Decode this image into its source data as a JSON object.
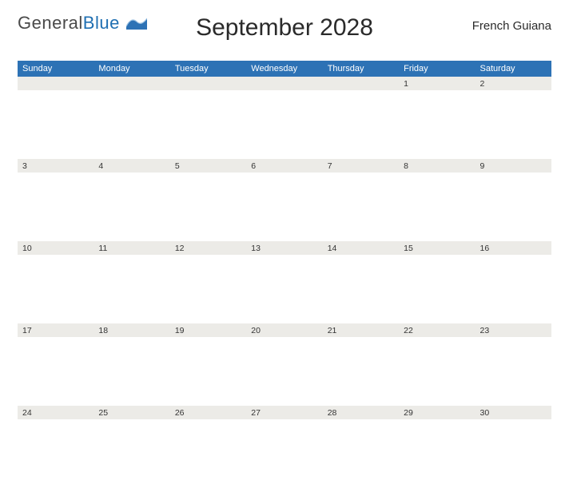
{
  "logo": {
    "part1": "General",
    "part2": "Blue"
  },
  "title": "September 2028",
  "region": "French Guiana",
  "day_headers": [
    "Sunday",
    "Monday",
    "Tuesday",
    "Wednesday",
    "Thursday",
    "Friday",
    "Saturday"
  ],
  "weeks": [
    [
      "",
      "",
      "",
      "",
      "",
      "1",
      "2"
    ],
    [
      "3",
      "4",
      "5",
      "6",
      "7",
      "8",
      "9"
    ],
    [
      "10",
      "11",
      "12",
      "13",
      "14",
      "15",
      "16"
    ],
    [
      "17",
      "18",
      "19",
      "20",
      "21",
      "22",
      "23"
    ],
    [
      "24",
      "25",
      "26",
      "27",
      "28",
      "29",
      "30"
    ]
  ],
  "colors": {
    "accent": "#2d72b5",
    "numband": "#ecebe7"
  }
}
